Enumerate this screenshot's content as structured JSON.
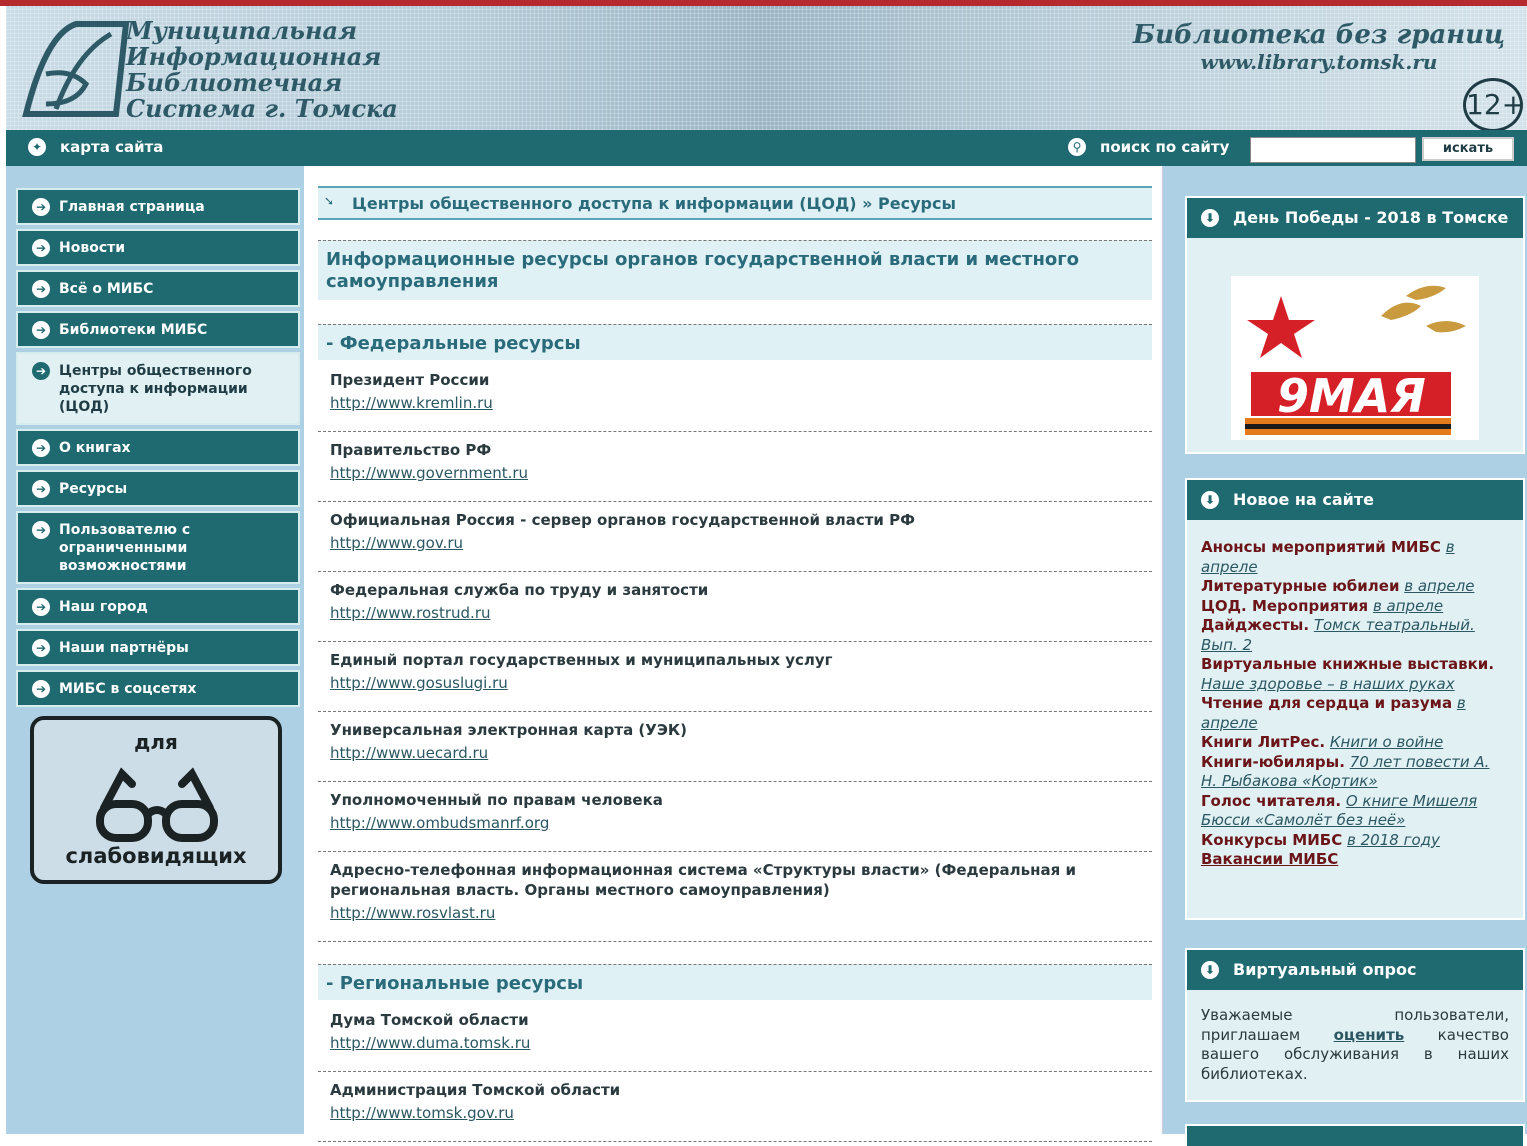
{
  "header": {
    "logo_lines": [
      "Муниципальная",
      "Информационная",
      "Библиотечная",
      "Система   г. Томска"
    ],
    "tagline": "Библиотека без границ",
    "url": "www.library.tomsk.ru",
    "age_rating": "12+"
  },
  "toolbar": {
    "sitemap": "карта сайта",
    "search_label": "поиск по сайту",
    "search_value": "",
    "search_button": "искать"
  },
  "nav": [
    {
      "label": "Главная страница"
    },
    {
      "label": "Новости"
    },
    {
      "label": "Всё о МИБС"
    },
    {
      "label": "Библиотеки МИБС"
    },
    {
      "label": "Центры общественного доступа к информации (ЦОД)",
      "active": true
    },
    {
      "label": "О книгах"
    },
    {
      "label": "Ресурсы"
    },
    {
      "label": "Пользователю с ограниченными возможностями"
    },
    {
      "label": "Наш город"
    },
    {
      "label": "Наши партнёры"
    },
    {
      "label": "МИБС в соцсетях"
    }
  ],
  "lowvision": {
    "top": "для",
    "bottom": "слабовидящих"
  },
  "breadcrumb": "Центры общественного доступа к информации (ЦОД) » Ресурсы",
  "page_title": "Информационные ресурсы органов государственной власти и местного самоуправления",
  "sections": [
    {
      "title": "- Федеральные ресурсы",
      "entries": [
        {
          "title": "Президент России",
          "url": "http://www.kremlin.ru"
        },
        {
          "title": "Правительство РФ",
          "url": "http://www.government.ru"
        },
        {
          "title": "Официальная Россия - сервер органов государственной власти РФ",
          "url": "http://www.gov.ru"
        },
        {
          "title": "Федеральная служба по труду и занятости",
          "url": "http://www.rostrud.ru"
        },
        {
          "title": "Единый портал государственных и муниципальных услуг",
          "url": "http://www.gosuslugi.ru"
        },
        {
          "title": "Универсальная электронная карта (УЭК)",
          "url": "http://www.uecard.ru"
        },
        {
          "title": "Уполномоченный по правам человека",
          "url": "http://www.ombudsmanrf.org"
        },
        {
          "title": "Адресно-телефонная информационная система «Структуры власти» (Федеральная и региональная власть. Органы местного самоуправления)",
          "url": "http://www.rosvlast.ru"
        }
      ]
    },
    {
      "title": "- Региональные ресурсы",
      "entries": [
        {
          "title": "Дума Томской области",
          "url": "http://www.duma.tomsk.ru"
        },
        {
          "title": "Администрация Томской области",
          "url": "http://www.tomsk.gov.ru"
        }
      ]
    }
  ],
  "victory_box": {
    "title": "День Победы - 2018 в Томске",
    "banner_text": "9МАЯ"
  },
  "news_box": {
    "title": "Новое на сайте",
    "items": [
      {
        "bold": "Анонсы мероприятий МИБС",
        "link": "в апреле"
      },
      {
        "bold": "Литературные юбилеи",
        "link": "в апреле"
      },
      {
        "bold": "ЦОД. Мероприятия",
        "link": "в апреле"
      },
      {
        "bold": "Дайджесты.",
        "link": "Томск театральный. Вып. 2"
      },
      {
        "bold": "Виртуальные книжные выставки.",
        "link": "Наше здоровье – в наших руках"
      },
      {
        "bold": "Чтение для сердца и разума",
        "link": "в апреле"
      },
      {
        "bold": "Книги ЛитРес.",
        "link": "Книги о войне"
      },
      {
        "bold": "Книги-юбиляры.",
        "link": "70 лет повести А. Н. Рыбакова «Кортик»"
      },
      {
        "bold": "Голос читателя.",
        "link": "О книге Мишеля Бюсси «Самолёт без неё»"
      },
      {
        "bold": "Конкурсы МИБС",
        "link": "в 2018 году"
      },
      {
        "bold": "Вакансии МИБС",
        "link": ""
      }
    ]
  },
  "poll_box": {
    "title": "Виртуальный опрос",
    "text_before": "Уважаемые пользователи, приглашаем",
    "link": "оценить",
    "text_after": "качество вашего обслуживания в наших библиотеках."
  }
}
